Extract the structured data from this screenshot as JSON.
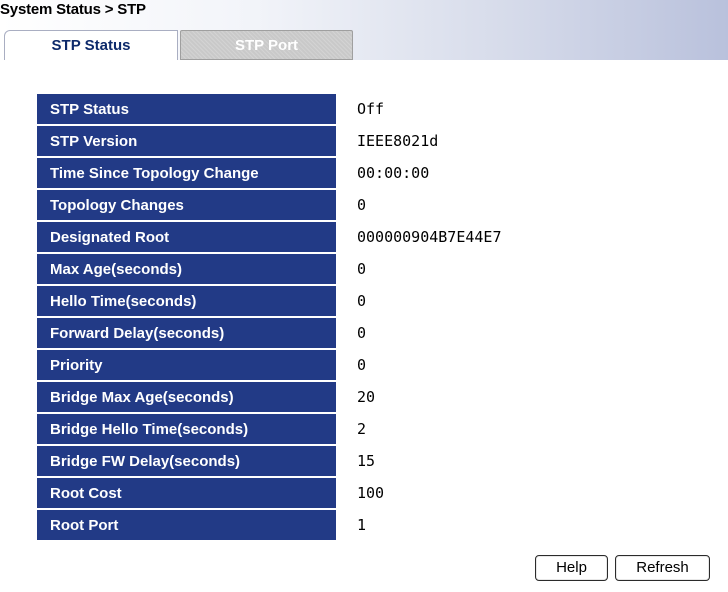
{
  "breadcrumb": "System Status > STP",
  "tabs": [
    {
      "label": "STP Status",
      "active": true
    },
    {
      "label": "STP Port",
      "active": false
    }
  ],
  "rows": [
    {
      "label": "STP Status",
      "value": "Off"
    },
    {
      "label": "STP Version",
      "value": "IEEE8021d"
    },
    {
      "label": "Time Since Topology Change",
      "value": "00:00:00"
    },
    {
      "label": "Topology Changes",
      "value": "0"
    },
    {
      "label": "Designated Root",
      "value": "000000904B7E44E7"
    },
    {
      "label": "Max Age(seconds)",
      "value": "0"
    },
    {
      "label": "Hello Time(seconds)",
      "value": "0"
    },
    {
      "label": "Forward Delay(seconds)",
      "value": "0"
    },
    {
      "label": "Priority",
      "value": "0"
    },
    {
      "label": "Bridge Max Age(seconds)",
      "value": "20"
    },
    {
      "label": "Bridge Hello Time(seconds)",
      "value": "2"
    },
    {
      "label": "Bridge FW Delay(seconds)",
      "value": "15"
    },
    {
      "label": "Root Cost",
      "value": "100"
    },
    {
      "label": "Root Port",
      "value": "1"
    }
  ],
  "buttons": {
    "help": "Help",
    "refresh": "Refresh"
  },
  "colors": {
    "label_bg": "#223a86",
    "tab_active_text": "#0d2a6b"
  }
}
